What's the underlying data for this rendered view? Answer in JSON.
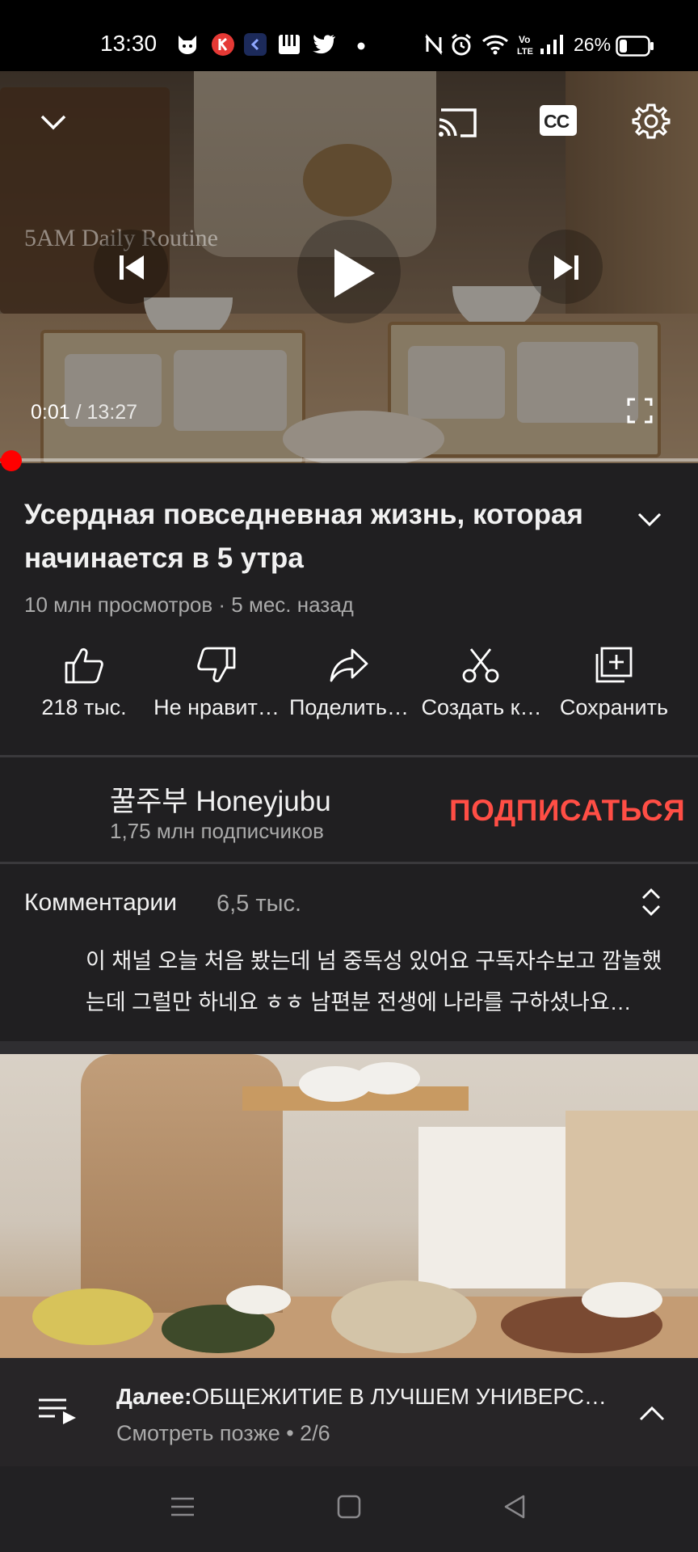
{
  "status_bar": {
    "time": "13:30",
    "battery_percent": "26%",
    "battery_level": 0.26,
    "icons": [
      "cat-app-icon",
      "k-app-icon",
      "app-back-icon",
      "piano-app-icon",
      "twitter-icon",
      "dot-icon",
      "nfc-off-icon",
      "alarm-icon",
      "wifi-icon",
      "volte-icon",
      "signal-icon",
      "battery-icon"
    ]
  },
  "player": {
    "overlay_text": "5AM Daily Routine",
    "current_time": "0:01",
    "separator": " / ",
    "total_time": "13:27",
    "progress": 0.0013,
    "icons": [
      "collapse-chevron-icon",
      "cast-icon",
      "captions-icon",
      "settings-gear-icon",
      "previous-icon",
      "play-icon",
      "next-icon",
      "fullscreen-icon"
    ],
    "captions_label": "CC"
  },
  "video": {
    "title": "Усердная повседневная жизнь, которая начинается в 5 утра",
    "meta": "10 млн просмотров · 5 мес. назад"
  },
  "actions": [
    {
      "label": "218 тыс.",
      "icon": "thumbs-up-icon"
    },
    {
      "label": "Не нравит…",
      "icon": "thumbs-down-icon"
    },
    {
      "label": "Поделить…",
      "icon": "share-icon"
    },
    {
      "label": "Создать к…",
      "icon": "scissors-icon"
    },
    {
      "label": "Сохранить",
      "icon": "save-playlist-icon"
    }
  ],
  "channel": {
    "name": "꿀주부 Honeyjubu",
    "subscribers": "1,75 млн подписчиков",
    "subscribe_label": "ПОДПИСАТЬСЯ",
    "subscribe_color": "#ff4e45"
  },
  "comments": {
    "title": "Комментарии",
    "count": "6,5 тыс.",
    "top_comment": "이 채널 오늘 처음 봤는데 넘 중독성 있어요 구독자수보고 깜놀했는데 그럴만 하네요 ㅎㅎ 남편분 전생에 나라를 구하셨나요…"
  },
  "up_next": {
    "prefix": "Далее:",
    "title": "ОБЩЕЖИТИЕ В ЛУЧШЕМ УНИВЕРС…",
    "playlist": "Смотреть позже • 2/6"
  },
  "colors": {
    "background": "#201f21",
    "accent_red": "#ff0000",
    "subscribe": "#ff4e45",
    "secondary_text": "#aaaaaa"
  }
}
